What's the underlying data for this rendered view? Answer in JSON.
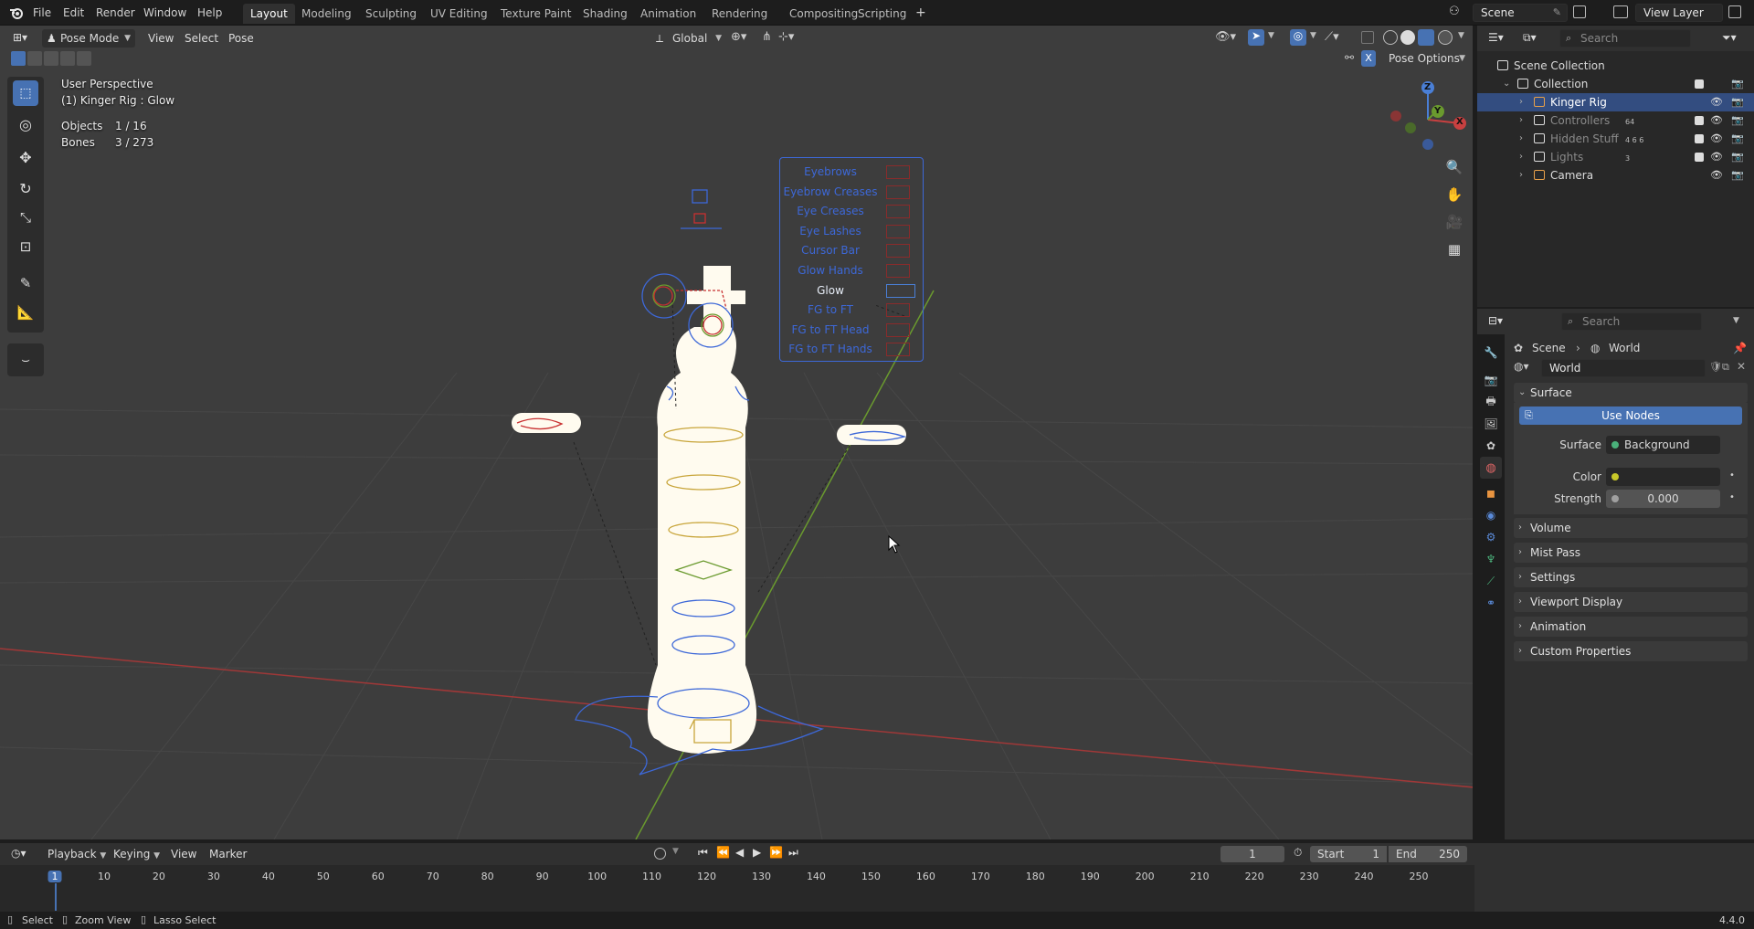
{
  "topbar": {
    "menus": [
      "File",
      "Edit",
      "Render",
      "Window",
      "Help"
    ],
    "workspaces": [
      "Layout",
      "Modeling",
      "Sculpting",
      "UV Editing",
      "Texture Paint",
      "Shading",
      "Animation",
      "Rendering",
      "Compositing",
      "Scripting"
    ],
    "add_workspace": "+",
    "scene_name": "Scene",
    "view_layer": "View Layer"
  },
  "viewport": {
    "mode": "Pose Mode",
    "menus": [
      "View",
      "Select",
      "Pose"
    ],
    "orientation": "Global",
    "pose_options": "Pose Options",
    "x_mirror": "X",
    "info": {
      "perspective": "User Perspective",
      "active": "(1) Kinger Rig : Glow",
      "objects_label": "Objects",
      "objects_value": "1 / 16",
      "bones_label": "Bones",
      "bones_value": "3 / 273"
    },
    "gizmo_axes": [
      "Z",
      "Y",
      "X"
    ],
    "widget_labels": [
      "Eyebrows",
      "Eyebrow Creases",
      "Eye Creases",
      "Eye Lashes",
      "Cursor Bar",
      "Glow Hands",
      "Glow",
      "FG to FT",
      "FG to FT Head",
      "FG to FT Hands"
    ],
    "widget_active": "Glow"
  },
  "outliner": {
    "search_placeholder": "Search",
    "root": "Scene Collection",
    "items": [
      {
        "label": "Collection",
        "indent": 1
      },
      {
        "label": "Kinger Rig",
        "indent": 2,
        "selected": true
      },
      {
        "label": "Controllers",
        "indent": 2,
        "badge": "64"
      },
      {
        "label": "Hidden Stuff",
        "indent": 2,
        "badge": "4 6 6"
      },
      {
        "label": "Lights",
        "indent": 2,
        "badge": "3"
      },
      {
        "label": "Camera",
        "indent": 2
      }
    ]
  },
  "properties": {
    "search_placeholder": "Search",
    "breadcrumb": [
      "Scene",
      "World"
    ],
    "world_name": "World",
    "surface_panel": "Surface",
    "use_nodes": "Use Nodes",
    "surface_label": "Surface",
    "surface_value": "Background",
    "color_label": "Color",
    "strength_label": "Strength",
    "strength_value": "0.000",
    "panels": [
      "Volume",
      "Mist Pass",
      "Settings",
      "Viewport Display",
      "Animation",
      "Custom Properties"
    ]
  },
  "timeline": {
    "menus": [
      "Playback",
      "Keying",
      "View",
      "Marker"
    ],
    "current_frame": "1",
    "start_label": "Start",
    "start_value": "1",
    "end_label": "End",
    "end_value": "250",
    "ticks": [
      "1",
      "10",
      "20",
      "30",
      "40",
      "50",
      "60",
      "70",
      "80",
      "90",
      "100",
      "110",
      "120",
      "130",
      "140",
      "150",
      "160",
      "170",
      "180",
      "190",
      "200",
      "210",
      "220",
      "230",
      "240",
      "250"
    ]
  },
  "statusbar": {
    "items": [
      "Select",
      "Zoom View",
      "Lasso Select"
    ],
    "version": "4.4.0"
  },
  "colors": {
    "accent": "#4772b3",
    "selected_row": "#334d80",
    "x_axis": "#b84040",
    "y_axis": "#6a9a2e",
    "z_axis": "#4a7fd6",
    "rig_blue": "#3d68d8",
    "rig_red": "#c83030",
    "current_frame": "#4772b3"
  }
}
